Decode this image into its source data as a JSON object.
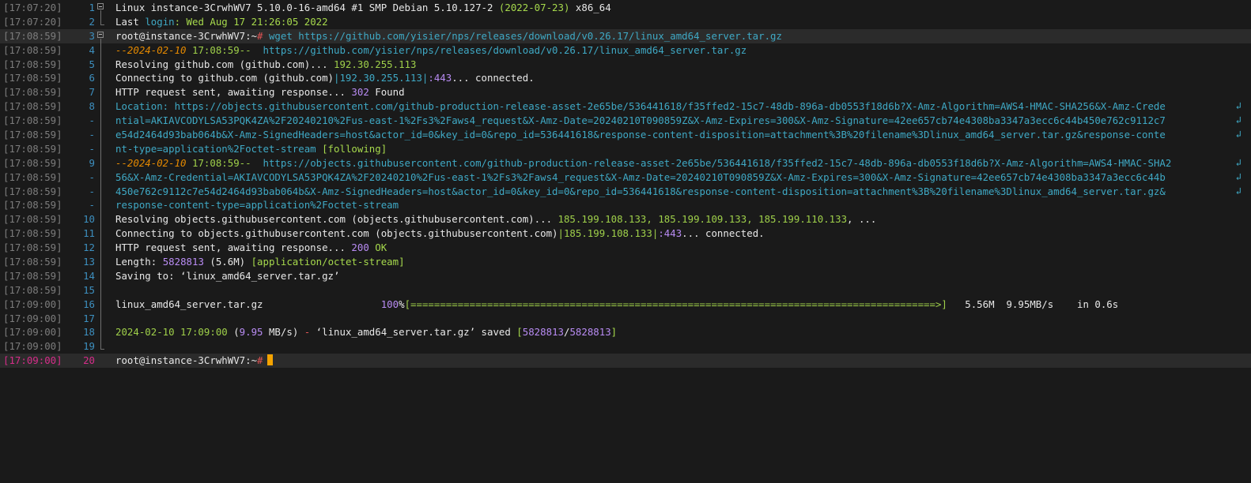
{
  "terminal": {
    "lines": [
      {
        "ts": "[17:07:20]",
        "ln": "1",
        "fold": "open",
        "segs": [
          [
            "Linux instance-3CrwhWV7 5.10.0-16-amd64 ",
            "c-white"
          ],
          [
            "#1",
            "c-white"
          ],
          [
            " SMP Debian 5.10.127-2 ",
            "c-white"
          ],
          [
            "(2022-07-23)",
            "c-green"
          ],
          [
            " x86_64",
            "c-white"
          ]
        ]
      },
      {
        "ts": "[17:07:20]",
        "ln": "2",
        "fold": "end",
        "segs": [
          [
            "Last ",
            "c-white"
          ],
          [
            "login",
            "c-url"
          ],
          [
            ": Wed Aug 17 21:26:05 2022",
            "c-green"
          ]
        ]
      },
      {
        "ts": "[17:08:59]",
        "ln": "3",
        "fold": "open",
        "sel": true,
        "segs": [
          [
            "root@instance-3CrwhWV7:~",
            "c-white"
          ],
          [
            "#",
            "c-red"
          ],
          [
            " wget https://github.com/yisier/nps/releases/download/v0.26.17/linux_amd64_server.tar.gz",
            "c-url"
          ]
        ]
      },
      {
        "ts": "[17:08:59]",
        "ln": "4",
        "fold": "mid",
        "segs": [
          [
            "--2024-02-10",
            "c-date-i"
          ],
          [
            " 17:08:59--  ",
            "c-olive"
          ],
          [
            "https://github.com/yisier/nps/releases/download/v0.26.17/linux_amd64_server.tar.gz",
            "c-url"
          ]
        ]
      },
      {
        "ts": "[17:08:59]",
        "ln": "5",
        "fold": "mid",
        "segs": [
          [
            "Resolving github.com (github.com)... ",
            "c-white"
          ],
          [
            "192.30.255.113",
            "c-olive"
          ]
        ]
      },
      {
        "ts": "[17:08:59]",
        "ln": "6",
        "fold": "mid",
        "segs": [
          [
            "Connecting to github.com (github.com)",
            "c-white"
          ],
          [
            "|192.30.255.113|",
            "c-url"
          ],
          [
            ":443",
            "c-num"
          ],
          [
            "... connected.",
            "c-white"
          ]
        ]
      },
      {
        "ts": "[17:08:59]",
        "ln": "7",
        "fold": "mid",
        "segs": [
          [
            "HTTP request sent, awaiting response... ",
            "c-white"
          ],
          [
            "302",
            "c-num"
          ],
          [
            " Found",
            "c-white"
          ]
        ]
      },
      {
        "ts": "[17:08:59]",
        "ln": "8",
        "fold": "mid",
        "wrap": true,
        "segs": [
          [
            "Location: ",
            "c-url"
          ],
          [
            "https://objects.githubusercontent.com/github-production-release-asset-2e65be/536441618/f35ffed2-15c7-48db-896a-db0553f18d6b?X-Amz-Algorithm=AWS4-HMAC-SHA256&X-Amz-Crede",
            "c-url"
          ]
        ]
      },
      {
        "ts": "[17:08:59]",
        "ln": "-",
        "fold": "mid",
        "wrap": true,
        "segs": [
          [
            "ntial=AKIAVCODYLSA53PQK4ZA%2F20240210%2Fus-east-1%2Fs3%2Faws4_request&X-Amz-Date=20240210T090859Z&X-Amz-Expires=300&X-Amz-Signature=42ee657cb74e4308ba3347a3ecc6c44b450e762c9112c7",
            "c-url"
          ]
        ]
      },
      {
        "ts": "[17:08:59]",
        "ln": "-",
        "fold": "mid",
        "wrap": true,
        "segs": [
          [
            "e54d2464d93bab064b&X-Amz-SignedHeaders=host&actor_id=0&key_id=0&repo_id=536441618&response-content-disposition=attachment%3B%20filename%3Dlinux_amd64_server.tar.gz&response-conte",
            "c-url"
          ]
        ]
      },
      {
        "ts": "[17:08:59]",
        "ln": "-",
        "fold": "mid",
        "segs": [
          [
            "nt-type=application%2Foctet-stream",
            "c-url"
          ],
          [
            " [following]",
            "c-green"
          ]
        ]
      },
      {
        "ts": "[17:08:59]",
        "ln": "9",
        "fold": "mid",
        "wrap": true,
        "segs": [
          [
            "--2024-02-10",
            "c-date-i"
          ],
          [
            " 17:08:59--  ",
            "c-olive"
          ],
          [
            "https://objects.githubusercontent.com/github-production-release-asset-2e65be/536441618/f35ffed2-15c7-48db-896a-db0553f18d6b?X-Amz-Algorithm=AWS4-HMAC-SHA2",
            "c-url"
          ]
        ]
      },
      {
        "ts": "[17:08:59]",
        "ln": "-",
        "fold": "mid",
        "wrap": true,
        "segs": [
          [
            "56&X-Amz-Credential=AKIAVCODYLSA53PQK4ZA%2F20240210%2Fus-east-1%2Fs3%2Faws4_request&X-Amz-Date=20240210T090859Z&X-Amz-Expires=300&X-Amz-Signature=42ee657cb74e4308ba3347a3ecc6c44b",
            "c-url"
          ]
        ]
      },
      {
        "ts": "[17:08:59]",
        "ln": "-",
        "fold": "mid",
        "wrap": true,
        "segs": [
          [
            "450e762c9112c7e54d2464d93bab064b&X-Amz-SignedHeaders=host&actor_id=0&key_id=0&repo_id=536441618&response-content-disposition=attachment%3B%20filename%3Dlinux_amd64_server.tar.gz&",
            "c-url"
          ]
        ]
      },
      {
        "ts": "[17:08:59]",
        "ln": "-",
        "fold": "mid",
        "segs": [
          [
            "response-content-type=application%2Foctet-stream",
            "c-url"
          ]
        ]
      },
      {
        "ts": "[17:08:59]",
        "ln": "10",
        "fold": "mid",
        "segs": [
          [
            "Resolving objects.githubusercontent.com (objects.githubusercontent.com)... ",
            "c-white"
          ],
          [
            "185.199.108.133, 185.199.109.133, 185.199.110.133",
            "c-olive"
          ],
          [
            ", ...",
            "c-white"
          ]
        ]
      },
      {
        "ts": "[17:08:59]",
        "ln": "11",
        "fold": "mid",
        "segs": [
          [
            "Connecting to objects.githubusercontent.com (objects.githubusercontent.com)",
            "c-white"
          ],
          [
            "|185.199.108.133|",
            "c-olive"
          ],
          [
            ":443",
            "c-num"
          ],
          [
            "... connected.",
            "c-white"
          ]
        ]
      },
      {
        "ts": "[17:08:59]",
        "ln": "12",
        "fold": "mid",
        "segs": [
          [
            "HTTP request sent, awaiting response... ",
            "c-white"
          ],
          [
            "200",
            "c-num"
          ],
          [
            " OK",
            "c-green"
          ]
        ]
      },
      {
        "ts": "[17:08:59]",
        "ln": "13",
        "fold": "mid",
        "segs": [
          [
            "Length",
            "c-white"
          ],
          [
            ": ",
            "c-white"
          ],
          [
            "5828813",
            "c-num"
          ],
          [
            " (5.6M) ",
            "c-white"
          ],
          [
            "[application/octet-stream]",
            "c-green"
          ]
        ]
      },
      {
        "ts": "[17:08:59]",
        "ln": "14",
        "fold": "mid",
        "segs": [
          [
            "Saving to: ‘linux_amd64_server.tar.gz’",
            "c-white"
          ]
        ]
      },
      {
        "ts": "[17:08:59]",
        "ln": "15",
        "fold": "mid",
        "segs": []
      },
      {
        "ts": "[17:09:00]",
        "ln": "16",
        "fold": "mid",
        "segs": [
          [
            "linux_amd64_server.tar.gz                    ",
            "c-white"
          ],
          [
            "100",
            "c-num"
          ],
          [
            "%",
            "c-white"
          ],
          [
            "[=========================================================================================>]",
            "c-olive"
          ],
          [
            "   5.56M  9.95MB/s    in 0.6s",
            "c-white"
          ]
        ]
      },
      {
        "ts": "[17:09:00]",
        "ln": "17",
        "fold": "mid",
        "segs": []
      },
      {
        "ts": "[17:09:00]",
        "ln": "18",
        "fold": "mid",
        "segs": [
          [
            "2024-02-10 17:09:00",
            "c-olive"
          ],
          [
            " (",
            "c-white"
          ],
          [
            "9.95",
            "c-num"
          ],
          [
            " MB/s) ",
            "c-white"
          ],
          [
            "-",
            "c-red"
          ],
          [
            " ‘linux_amd64_server.tar.gz’ saved ",
            "c-white"
          ],
          [
            "[",
            "c-green"
          ],
          [
            "5828813",
            "c-num"
          ],
          [
            "/",
            "c-white"
          ],
          [
            "5828813",
            "c-num"
          ],
          [
            "]",
            "c-green"
          ]
        ]
      },
      {
        "ts": "[17:09:00]",
        "ln": "19",
        "fold": "end",
        "segs": []
      },
      {
        "ts": "[17:09:00]",
        "ln": "20",
        "fold": "none",
        "current": true,
        "sel": true,
        "cursor": true,
        "segs": [
          [
            "root@instance-3CrwhWV7:~",
            "c-white"
          ],
          [
            "#",
            "c-red"
          ]
        ]
      }
    ],
    "wrap_glyph": "↲",
    "colors": {
      "background": "#1a1a1a",
      "timestamp": "#7c7c7c",
      "line_number": "#3d8fbf",
      "current_line_number": "#d62d8a",
      "url": "#3fa9c5",
      "number": "#b98cf4",
      "green": "#a6d94c",
      "orange": "#e68a00",
      "cursor": "#f4a300"
    }
  }
}
